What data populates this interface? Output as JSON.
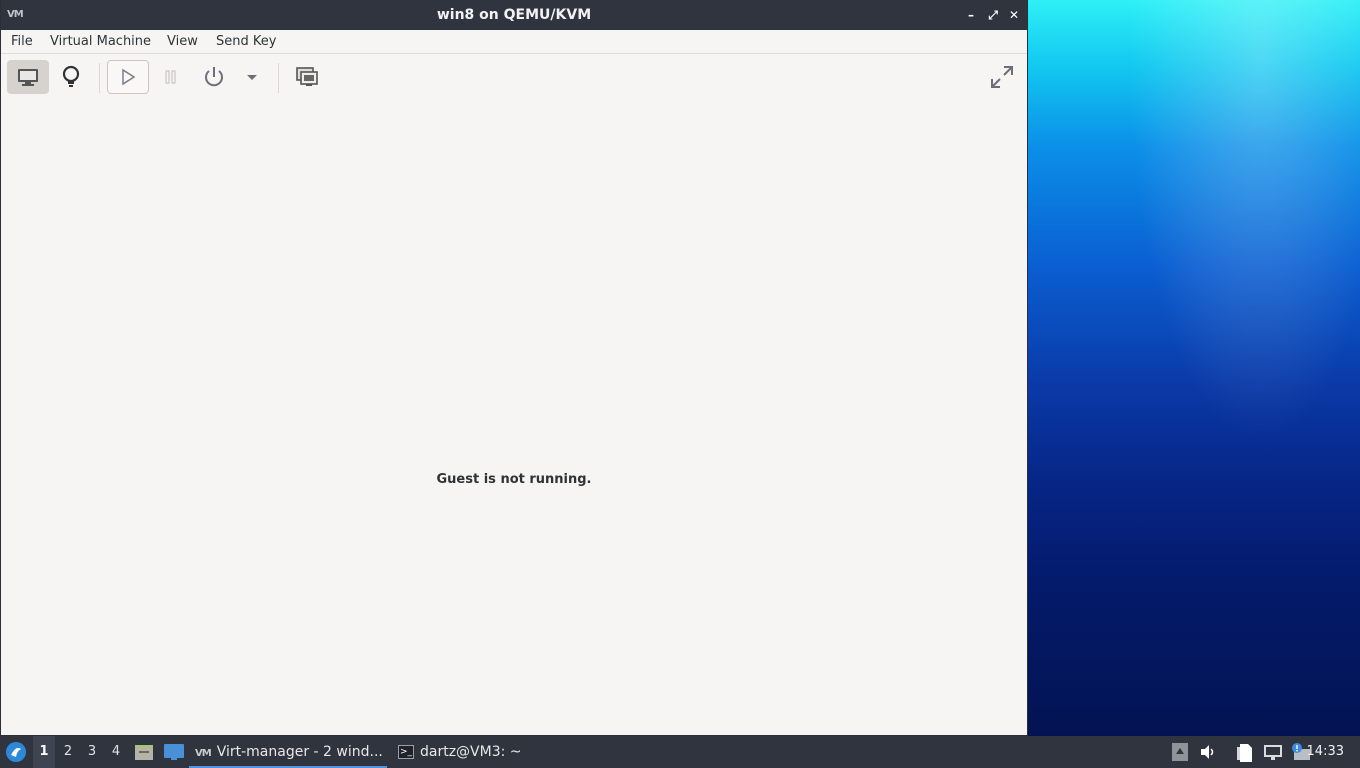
{
  "window": {
    "app_icon_text": "VM",
    "title": "win8 on QEMU/KVM",
    "controls": {
      "minimize": "–",
      "maximize": "⤢",
      "close": "✕"
    }
  },
  "menubar": {
    "items": [
      "File",
      "Virtual Machine",
      "View",
      "Send Key"
    ]
  },
  "toolbar": {
    "buttons": [
      {
        "name": "console-view-button",
        "icon": "monitor-icon",
        "active": true
      },
      {
        "name": "details-view-button",
        "icon": "lightbulb-icon",
        "active": false
      },
      {
        "name": "run-button",
        "icon": "play-icon",
        "active": false
      },
      {
        "name": "pause-button",
        "icon": "pause-icon",
        "active": false,
        "disabled": true
      },
      {
        "name": "shutdown-button",
        "icon": "power-icon",
        "active": false
      },
      {
        "name": "shutdown-menu-button",
        "icon": "chevron-down-icon",
        "active": false
      },
      {
        "name": "snapshots-button",
        "icon": "snapshots-icon",
        "active": false
      },
      {
        "name": "fullscreen-button",
        "icon": "fullscreen-icon",
        "active": false
      }
    ]
  },
  "main": {
    "message": "Guest is not running."
  },
  "taskbar": {
    "workspaces": [
      "1",
      "2",
      "3",
      "4"
    ],
    "active_workspace": "1",
    "tasks": [
      {
        "label": "Virt-manager - 2 wind...",
        "icon": "virt-manager-icon",
        "active": true
      },
      {
        "label": "dartz@VM3: ~",
        "icon": "terminal-icon",
        "active": false
      }
    ],
    "clock": "14:33"
  },
  "colors": {
    "titlebar": "#2f343f",
    "window_bg": "#f6f5f4",
    "accent": "#5294e2",
    "text": "#2e3436"
  }
}
